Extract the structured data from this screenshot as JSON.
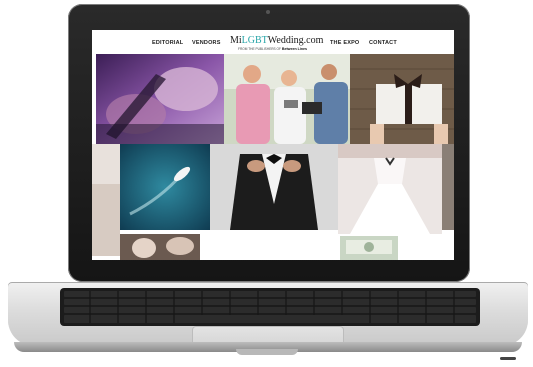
{
  "nav": {
    "editorial": "EDITORIAL",
    "vendors": "VENDORS",
    "logo_prefix": "Mi",
    "logo_accent": "LGBT",
    "logo_suffix": "Wedding.com",
    "tagline_prefix": "FROM THE PUBLISHERS OF",
    "tagline_brand": "Between Lines",
    "expo": "THE EXPO",
    "contact": "CONTACT"
  },
  "colors": {
    "accent": "#27a5a8",
    "laptop_bezel": "#1a1a1a",
    "keyboard": "#1c1c1c"
  },
  "photos": [
    {
      "name": "photo-hands-purple"
    },
    {
      "name": "photo-couple-ceremony"
    },
    {
      "name": "photo-gift-box"
    },
    {
      "name": "photo-boat-aerial"
    },
    {
      "name": "photo-tuxedo"
    },
    {
      "name": "photo-wedding-dress"
    },
    {
      "name": "photo-partial-bottom-left"
    },
    {
      "name": "photo-partial-bottom-right"
    }
  ]
}
